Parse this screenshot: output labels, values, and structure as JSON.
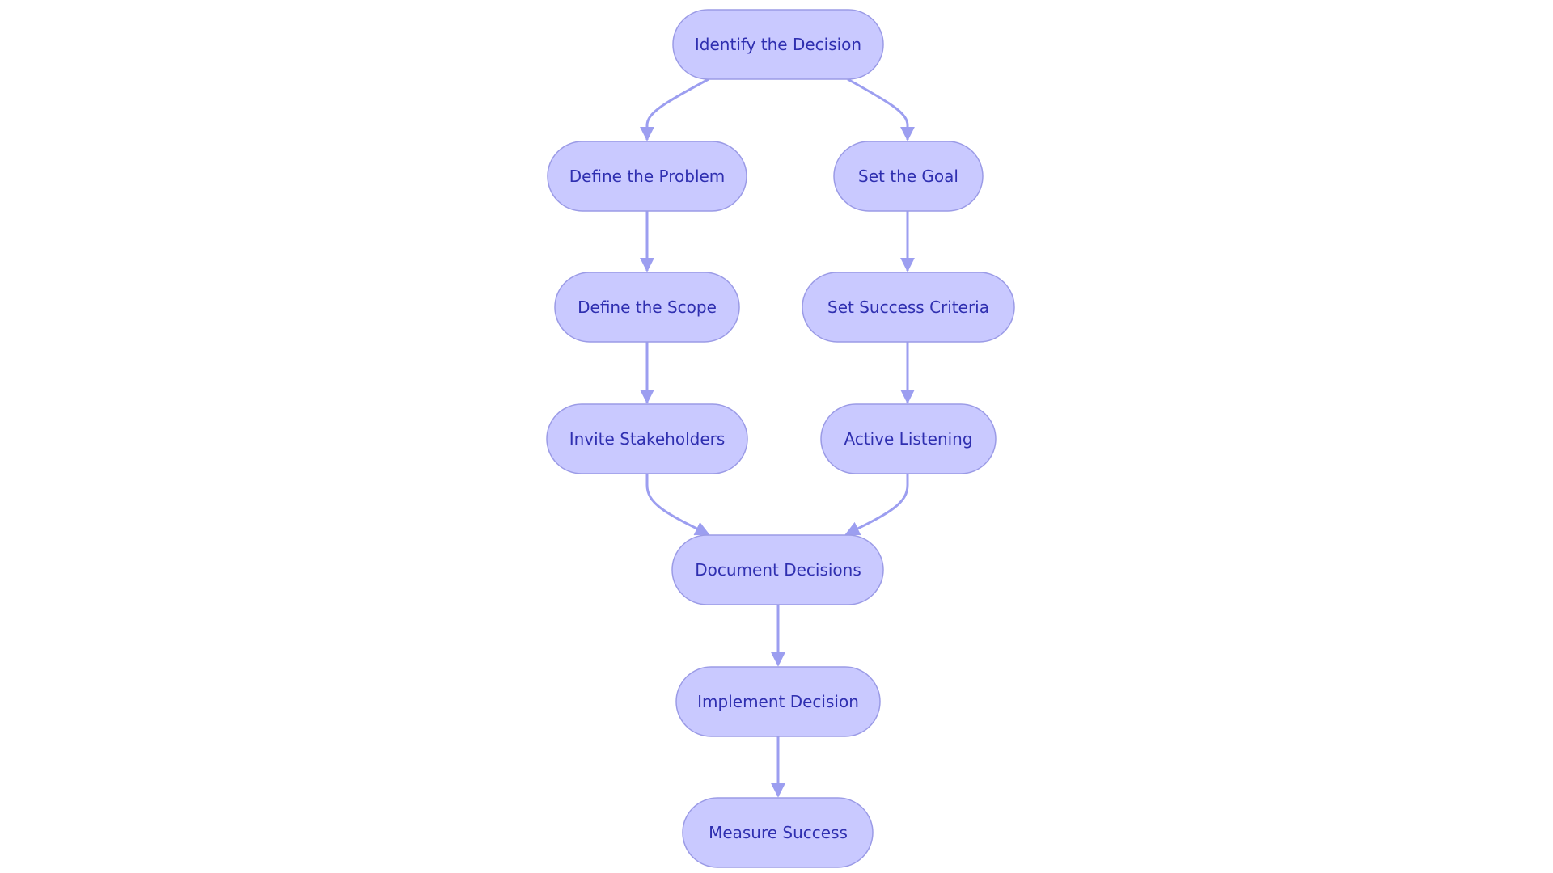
{
  "diagram": {
    "type": "flowchart",
    "colors": {
      "node_fill": "#c9c9ff",
      "node_stroke": "#9b9be6",
      "text": "#2f2fb0",
      "edge": "#9c9ef0"
    },
    "nodes": {
      "identify": "Identify the Decision",
      "problem": "Define the Problem",
      "goal": "Set the Goal",
      "scope": "Define the Scope",
      "criteria": "Set Success Criteria",
      "stakeholders": "Invite Stakeholders",
      "listening": "Active Listening",
      "document": "Document Decisions",
      "implement": "Implement Decision",
      "measure": "Measure Success"
    },
    "edges": [
      [
        "identify",
        "problem"
      ],
      [
        "identify",
        "goal"
      ],
      [
        "problem",
        "scope"
      ],
      [
        "scope",
        "stakeholders"
      ],
      [
        "goal",
        "criteria"
      ],
      [
        "criteria",
        "listening"
      ],
      [
        "stakeholders",
        "document"
      ],
      [
        "listening",
        "document"
      ],
      [
        "document",
        "implement"
      ],
      [
        "implement",
        "measure"
      ]
    ]
  }
}
